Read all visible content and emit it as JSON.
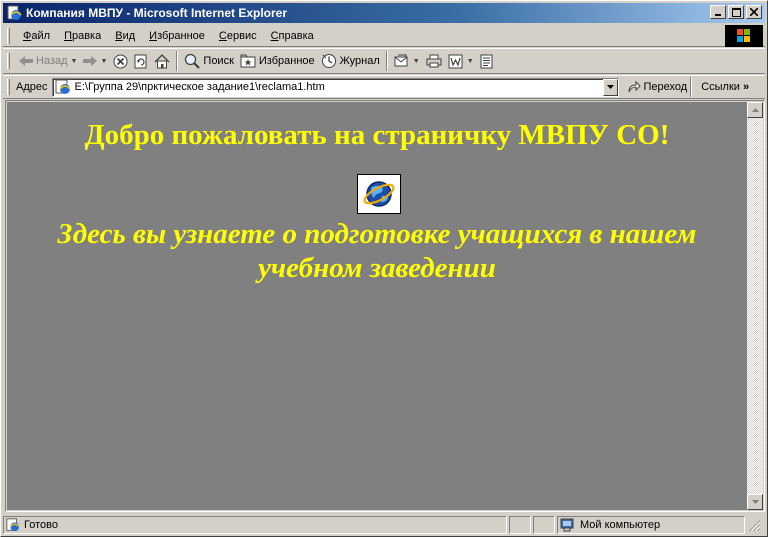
{
  "window": {
    "title": "Компания МВПУ - Microsoft Internet Explorer"
  },
  "menu": {
    "items": [
      {
        "key": "Ф",
        "rest": "айл"
      },
      {
        "key": "П",
        "rest": "равка"
      },
      {
        "key": "В",
        "rest": "ид"
      },
      {
        "key": "И",
        "rest": "збранное"
      },
      {
        "key": "С",
        "rest": "ервис"
      },
      {
        "key": "С",
        "rest": "правка"
      }
    ]
  },
  "toolbar": {
    "back_label": "Назад",
    "search_label": "Поиск",
    "favorites_label": "Избранное",
    "history_label": "Журнал"
  },
  "address": {
    "label": "Адрес",
    "url": "E:\\Группа 29\\пркти­ческое задание1\\reclama1.htm",
    "go_label": "Переход",
    "links_label": "Ссылки"
  },
  "page": {
    "heading": "Добро пожаловать на страничку МВПУ СО!",
    "subtitle": "Здесь вы узнаете о подготовке учащихся в нашем учебном заведении"
  },
  "status": {
    "text": "Готово",
    "zone": "Мой компьютер"
  },
  "colors": {
    "page_background": "#808080",
    "page_text": "#ffff00",
    "titlebar": "#0a246a"
  },
  "icons": {
    "app": "ie-page-icon",
    "content_image": "internet-explorer-globe-icon"
  }
}
